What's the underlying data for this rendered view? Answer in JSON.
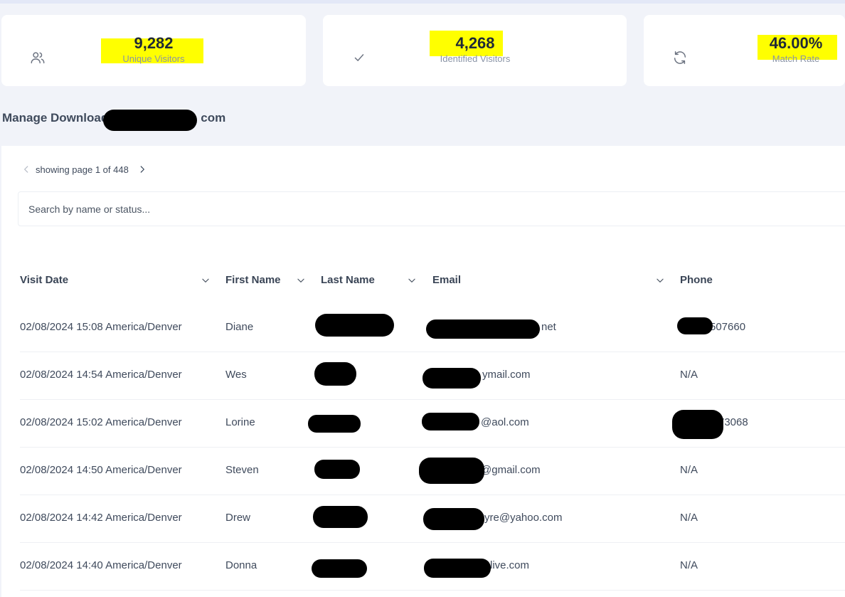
{
  "stats": [
    {
      "value": "9,282",
      "label": "Unique Visitors",
      "icon": "users-icon"
    },
    {
      "value": "4,268",
      "label": "Identified Visitors",
      "icon": "check-icon"
    },
    {
      "value": "46.00%",
      "label": "Match Rate",
      "icon": "refresh-icon"
    }
  ],
  "manage": {
    "prefix": "Manage Download",
    "suffix": "com"
  },
  "pager": {
    "text": "showing page 1 of 448"
  },
  "search": {
    "placeholder": "Search by name or status..."
  },
  "table": {
    "columns": [
      "Visit Date",
      "First Name",
      "Last Name",
      "Email",
      "Phone"
    ],
    "rows": [
      {
        "visit_date": "02/08/2024 15:08 America/Denver",
        "first_name": "Diane",
        "email": "net",
        "phone": "507660"
      },
      {
        "visit_date": "02/08/2024 14:54 America/Denver",
        "first_name": "Wes",
        "email": "ymail.com",
        "phone": "N/A"
      },
      {
        "visit_date": "02/08/2024 15:02 America/Denver",
        "first_name": "Lorine",
        "email": "@aol.com",
        "phone": "73068"
      },
      {
        "visit_date": "02/08/2024 14:50 America/Denver",
        "first_name": "Steven",
        "email": "@gmail.com",
        "phone": "N/A"
      },
      {
        "visit_date": "02/08/2024 14:42 America/Denver",
        "first_name": "Drew",
        "email": "yre@yahoo.com",
        "phone": "N/A"
      },
      {
        "visit_date": "02/08/2024 14:40 America/Denver",
        "first_name": "Donna",
        "email": "live.com",
        "phone": "N/A"
      }
    ]
  },
  "colors": {
    "highlight": "#ffff00",
    "background": "#f1f3f9",
    "card": "#ffffff"
  }
}
